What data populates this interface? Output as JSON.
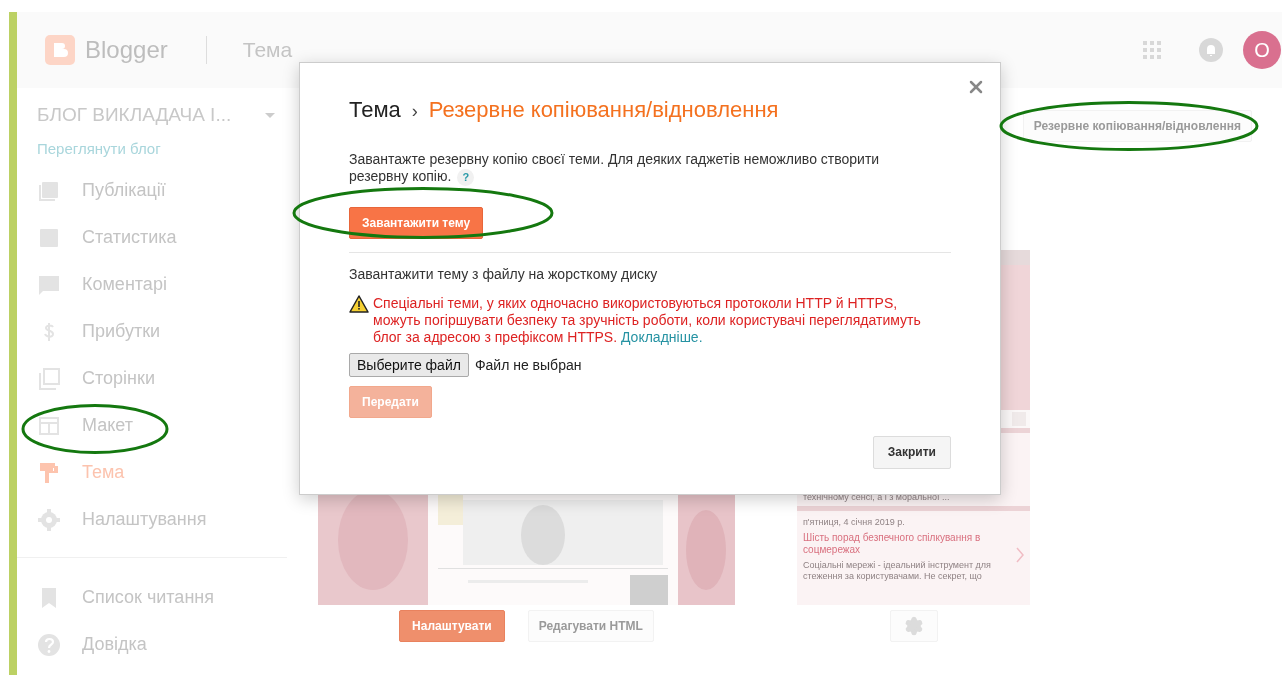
{
  "header": {
    "logo_text": "Blogger",
    "page_title": "Тема",
    "avatar_letter": "О"
  },
  "sidebar": {
    "blog_title": "БЛОГ ВИКЛАДАЧА І...",
    "view_blog": "Переглянути блог",
    "items": [
      {
        "label": "Публікації",
        "selected": false
      },
      {
        "label": "Статистика",
        "selected": false
      },
      {
        "label": "Коментарі",
        "selected": false
      },
      {
        "label": "Прибутки",
        "selected": false
      },
      {
        "label": "Сторінки",
        "selected": false
      },
      {
        "label": "Макет",
        "selected": false
      },
      {
        "label": "Тема",
        "selected": true
      },
      {
        "label": "Налаштування",
        "selected": false
      }
    ],
    "secondary_items": [
      {
        "label": "Список читання"
      },
      {
        "label": "Довідка"
      }
    ]
  },
  "main": {
    "backup_button": "Резервне копіювання/відновлення",
    "preview": {
      "excerpt_top": "технічному сенсі, а і з моральної ...",
      "date": "п'ятниця, 4 січня 2019 р.",
      "post_title": "Шість порад безпечного спілкування в соцмережах",
      "excerpt": "Соціальні мережі - ідеальний інструмент для стеження за користувачами. Не секрет, що"
    },
    "customize_button": "Налаштувати",
    "edit_html_button": "Редагувати HTML"
  },
  "dialog": {
    "breadcrumb_root": "Тема",
    "separator": "›",
    "breadcrumb_current": "Резервне копіювання/відновлення",
    "description": "Завантажте резервну копію своєї теми. Для деяких гаджетів неможливо створити резервну копію.",
    "help": "?",
    "download_button": "Завантажити тему",
    "upload_label": "Завантажити тему з файлу на жорсткому диску",
    "warning": {
      "text": "Спеціальні теми, у яких одночасно використовуються протоколи HTTP й HTTPS, можуть погіршувати безпеку та зручність роботи, коли користувачі переглядатимуть блог за адресою з префіксом HTTPS.",
      "link": "Докладніше."
    },
    "file_button": "Выберите файл",
    "file_status": "Файл не выбран",
    "upload_button": {
      "label": "Передати",
      "disabled": true
    },
    "close_button": "Закрити"
  }
}
